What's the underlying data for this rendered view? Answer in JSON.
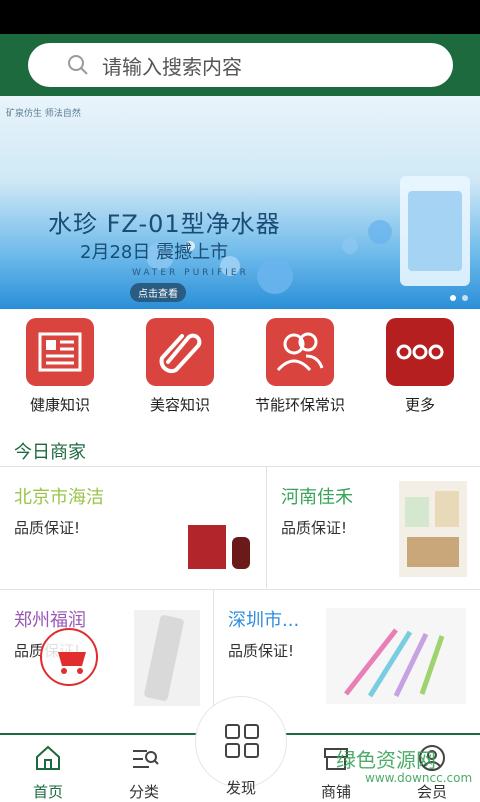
{
  "search": {
    "placeholder": "请输入搜索内容"
  },
  "banner": {
    "tag": "矿泉仿生 师法自然",
    "title": "水珍 FZ-01型净水器",
    "subtitle": "2月28日 震撼上市",
    "english": "WATER PURIFIER",
    "cta": "点击查看"
  },
  "categories": [
    {
      "label": "健康知识",
      "icon": "newspaper-icon"
    },
    {
      "label": "美容知识",
      "icon": "paperclip-icon"
    },
    {
      "label": "节能环保常识",
      "icon": "people-icon"
    },
    {
      "label": "更多",
      "icon": "more-dots-icon"
    }
  ],
  "section": {
    "title": "今日商家"
  },
  "merchants": [
    {
      "name": "北京市海洁",
      "sub": "品质保证!",
      "color": "#9bc44b"
    },
    {
      "name": "河南佳禾",
      "sub": "品质保证!",
      "color": "#39a45a"
    },
    {
      "name": "郑州福润",
      "sub": "品质保证!",
      "color": "#9a58b4"
    },
    {
      "name": "深圳市...",
      "sub": "品质保证!",
      "color": "#2f8de0"
    }
  ],
  "tabs": [
    {
      "label": "首页",
      "icon": "home-icon"
    },
    {
      "label": "分类",
      "icon": "category-icon"
    },
    {
      "label": "发现",
      "icon": "grid-icon"
    },
    {
      "label": "商铺",
      "icon": "shop-icon"
    },
    {
      "label": "会员",
      "icon": "user-icon"
    }
  ],
  "watermark": {
    "main": "绿色资源网",
    "sub": "www.downcc.com"
  },
  "colors": {
    "brand": "#1e6a3f",
    "accent": "#d9443f"
  }
}
